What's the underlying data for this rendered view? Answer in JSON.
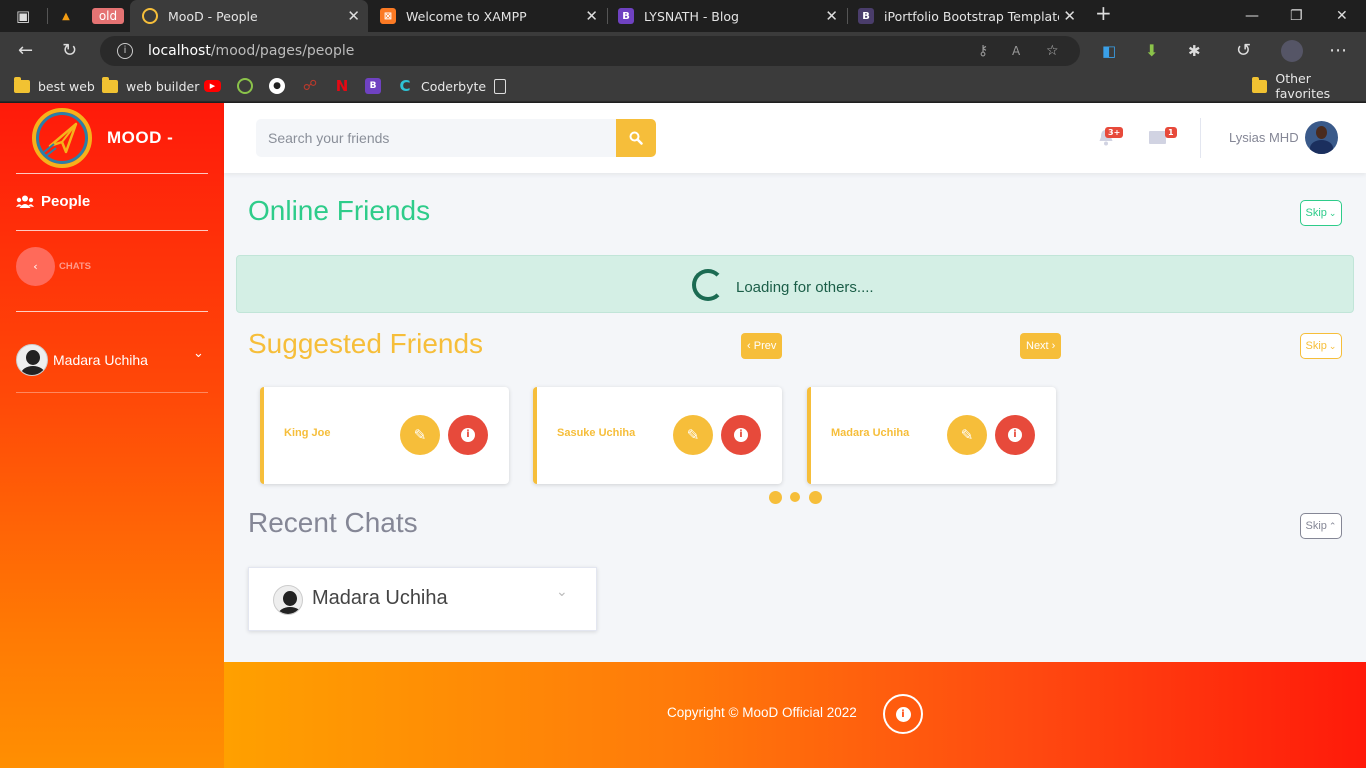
{
  "browser": {
    "tabs": [
      {
        "title": "old",
        "active": false
      },
      {
        "title": "MooD - People",
        "active": true
      },
      {
        "title": "Welcome to XAMPP",
        "active": false
      },
      {
        "title": "LYSNATH - Blog",
        "active": false
      },
      {
        "title": "iPortfolio Bootstrap Template - I",
        "active": false
      }
    ],
    "url_host": "localhost",
    "url_path": "/mood/pages/people",
    "bookmarks": [
      "best web",
      "web builder",
      "Coderbyte"
    ],
    "other_favorites": "Other favorites"
  },
  "sidebar": {
    "brand": "MOOD -",
    "people_label": "People",
    "chats_label": "CHATS",
    "user_name": "Madara Uchiha"
  },
  "topbar": {
    "search_placeholder": "Search your friends",
    "notif_badge": "3+",
    "msg_badge": "1",
    "user_name": "Lysias MHD"
  },
  "online": {
    "title": "Online Friends",
    "skip_label": "Skip",
    "loading_text": "Loading for others...."
  },
  "suggested": {
    "title": "Suggested Friends",
    "prev_label": "Prev",
    "next_label": "Next",
    "skip_label": "Skip",
    "friends": [
      "King Joe",
      "Sasuke Uchiha",
      "Madara Uchiha"
    ]
  },
  "recent": {
    "title": "Recent Chats",
    "skip_label": "Skip",
    "chat_name": "Madara Uchiha"
  },
  "footer": {
    "copyright": "Copyright © MooD Official 2022"
  },
  "colors": {
    "accent_yellow": "#f6be3a",
    "green": "#2ecc8a",
    "danger_red": "#e74a3b"
  }
}
